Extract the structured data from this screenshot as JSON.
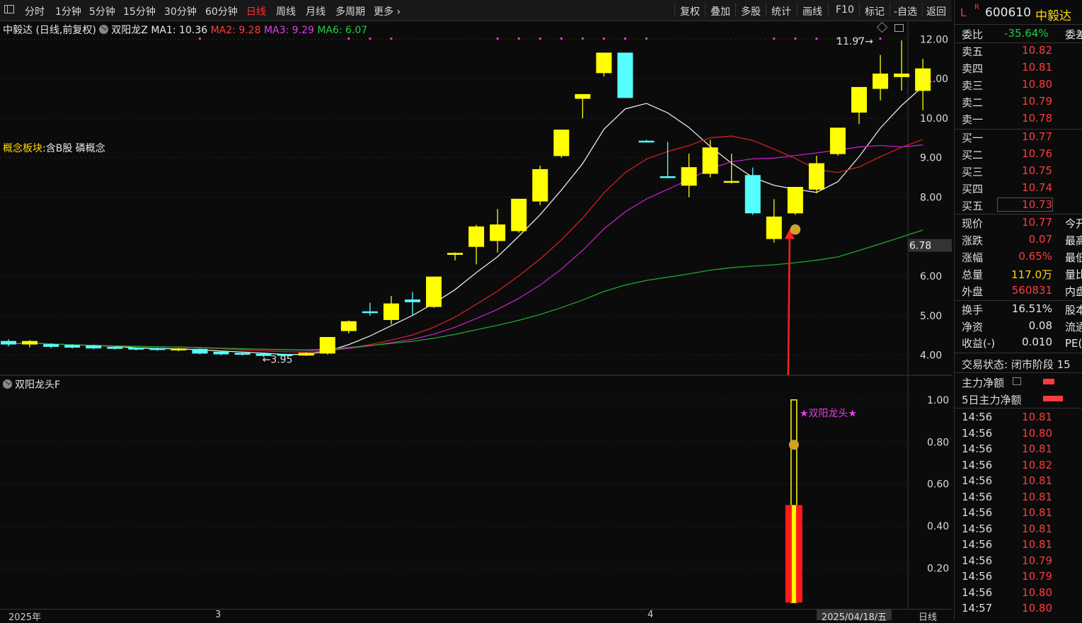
{
  "toolbar": {
    "tabs": [
      "分时",
      "1分钟",
      "5分钟",
      "15分钟",
      "30分钟",
      "60分钟",
      "日线",
      "周线",
      "月线",
      "多周期",
      "更多 ›"
    ],
    "active_tab": "日线",
    "right_buttons": [
      "复权",
      "叠加",
      "多股",
      "统计",
      "画线",
      "F10",
      "标记",
      "-自选",
      "返回"
    ]
  },
  "chart_header": {
    "title": "中毅达 (日线,前复权)",
    "formula": "双阳龙Z",
    "ma1": "MA1: 10.36",
    "ma2": "MA2: 9.28",
    "ma3": "MA3: 9.29",
    "ma6": "MA6: 6.07"
  },
  "concept": {
    "label": "概念板块",
    "value": ":含B股 磷概念"
  },
  "annotations": {
    "high": "11.97",
    "low": "3.95",
    "price_marker": "6.78"
  },
  "indicator": {
    "title": "双阳龙头F",
    "signal_text": "★双阳龙头★"
  },
  "y_axis_main": [
    "12.00",
    "11.00",
    "10.00",
    "9.00",
    "8.00",
    "6.00",
    "5.00",
    "4.00"
  ],
  "y_axis_ind": [
    "1.00",
    "0.80",
    "0.60",
    "0.40",
    "0.20"
  ],
  "date_axis": {
    "labels": [
      "2025年",
      "3",
      "4"
    ],
    "cursor": "2025/04/18/五",
    "period": "日线"
  },
  "colors": {
    "up": "#ffff00",
    "down": "#55ffff",
    "ma1": "#e8e8e8",
    "ma2": "#d02020",
    "ma3": "#c020c0",
    "ma6": "#1fa82a",
    "accent": "#ff3b3b"
  },
  "quote": {
    "code": "600610",
    "name": "中毅达",
    "badge_l": "L",
    "badge_r": "R",
    "weibi_label": "委比",
    "weibi": "-35.64%",
    "weicha_label": "委差",
    "sell": [
      {
        "l": "卖五",
        "p": "10.82"
      },
      {
        "l": "卖四",
        "p": "10.81"
      },
      {
        "l": "卖三",
        "p": "10.80"
      },
      {
        "l": "卖二",
        "p": "10.79"
      },
      {
        "l": "卖一",
        "p": "10.78"
      }
    ],
    "buy": [
      {
        "l": "买一",
        "p": "10.77"
      },
      {
        "l": "买二",
        "p": "10.76"
      },
      {
        "l": "买三",
        "p": "10.75"
      },
      {
        "l": "买四",
        "p": "10.74"
      },
      {
        "l": "买五",
        "p": "10.73"
      }
    ],
    "stats": [
      {
        "l": "现价",
        "v": "10.77",
        "r": "今开"
      },
      {
        "l": "涨跌",
        "v": "0.07",
        "r": "最高"
      },
      {
        "l": "涨幅",
        "v": "0.65%",
        "r": "最低"
      },
      {
        "l": "总量",
        "v": "117.0万",
        "r": "量比"
      },
      {
        "l": "外盘",
        "v": "560831",
        "r": "内盘"
      }
    ],
    "stats2": [
      {
        "l": "换手",
        "v": "16.51%",
        "r": "股本"
      },
      {
        "l": "净资",
        "v": "0.08",
        "r": "流通"
      },
      {
        "l": "收益(-)",
        "v": "0.010",
        "r": "PE(动)"
      }
    ],
    "trade_state": "交易状态: 闭市阶段 15",
    "main_net": "主力净额",
    "main_net5": "5日主力净额"
  },
  "ticks": [
    {
      "t": "14:56",
      "p": "10.81"
    },
    {
      "t": "14:56",
      "p": "10.80"
    },
    {
      "t": "14:56",
      "p": "10.81"
    },
    {
      "t": "14:56",
      "p": "10.82"
    },
    {
      "t": "14:56",
      "p": "10.81"
    },
    {
      "t": "14:56",
      "p": "10.81"
    },
    {
      "t": "14:56",
      "p": "10.81"
    },
    {
      "t": "14:56",
      "p": "10.81"
    },
    {
      "t": "14:56",
      "p": "10.81"
    },
    {
      "t": "14:56",
      "p": "10.79"
    },
    {
      "t": "14:56",
      "p": "10.79"
    },
    {
      "t": "14:56",
      "p": "10.80"
    },
    {
      "t": "14:57",
      "p": "10.80"
    }
  ],
  "candles": [
    {
      "o": 4.35,
      "c": 4.28,
      "h": 4.4,
      "l": 4.22
    },
    {
      "o": 4.28,
      "c": 4.35,
      "h": 4.38,
      "l": 4.2
    },
    {
      "o": 4.27,
      "c": 4.22,
      "h": 4.3,
      "l": 4.18
    },
    {
      "o": 4.25,
      "c": 4.2,
      "h": 4.27,
      "l": 4.17
    },
    {
      "o": 4.24,
      "c": 4.18,
      "h": 4.26,
      "l": 4.15
    },
    {
      "o": 4.2,
      "c": 4.17,
      "h": 4.22,
      "l": 4.14
    },
    {
      "o": 4.18,
      "c": 4.15,
      "h": 4.2,
      "l": 4.12
    },
    {
      "o": 4.17,
      "c": 4.14,
      "h": 4.19,
      "l": 4.11
    },
    {
      "o": 4.13,
      "c": 4.16,
      "h": 4.18,
      "l": 4.1
    },
    {
      "o": 4.15,
      "c": 4.05,
      "h": 4.17,
      "l": 4.02
    },
    {
      "o": 4.08,
      "c": 4.03,
      "h": 4.1,
      "l": 4.0
    },
    {
      "o": 4.05,
      "c": 4.02,
      "h": 4.08,
      "l": 3.99
    },
    {
      "o": 4.03,
      "c": 3.99,
      "h": 4.06,
      "l": 3.95
    },
    {
      "o": 4.02,
      "c": 4.0,
      "h": 4.04,
      "l": 3.97
    },
    {
      "o": 4.0,
      "c": 4.05,
      "h": 4.07,
      "l": 3.98
    },
    {
      "o": 4.05,
      "c": 4.45,
      "h": 4.45,
      "l": 4.02
    },
    {
      "o": 4.62,
      "c": 4.85,
      "h": 4.88,
      "l": 4.55
    },
    {
      "o": 5.1,
      "c": 5.08,
      "h": 5.33,
      "l": 5.0
    },
    {
      "o": 4.9,
      "c": 5.3,
      "h": 5.5,
      "l": 4.78
    },
    {
      "o": 5.4,
      "c": 5.35,
      "h": 5.6,
      "l": 5.0
    },
    {
      "o": 5.23,
      "c": 5.98,
      "h": 5.98,
      "l": 5.2
    },
    {
      "o": 6.55,
      "c": 6.58,
      "h": 6.6,
      "l": 6.4
    },
    {
      "o": 6.75,
      "c": 7.25,
      "h": 7.3,
      "l": 6.3
    },
    {
      "o": 6.9,
      "c": 7.3,
      "h": 7.7,
      "l": 6.6
    },
    {
      "o": 7.15,
      "c": 7.95,
      "h": 7.95,
      "l": 7.1
    },
    {
      "o": 7.9,
      "c": 8.7,
      "h": 8.8,
      "l": 7.8
    },
    {
      "o": 9.05,
      "c": 9.7,
      "h": 9.7,
      "l": 9.0
    },
    {
      "o": 10.5,
      "c": 10.6,
      "h": 10.6,
      "l": 10.0
    },
    {
      "o": 11.15,
      "c": 11.65,
      "h": 11.65,
      "l": 11.05
    },
    {
      "o": 11.65,
      "c": 10.52,
      "h": 11.65,
      "l": 10.52
    },
    {
      "o": 9.42,
      "c": 9.4,
      "h": 9.45,
      "l": 9.4
    },
    {
      "o": 8.52,
      "c": 8.5,
      "h": 9.4,
      "l": 8.5
    },
    {
      "o": 8.3,
      "c": 8.75,
      "h": 9.1,
      "l": 8.0
    },
    {
      "o": 8.6,
      "c": 9.25,
      "h": 9.45,
      "l": 8.5
    },
    {
      "o": 8.4,
      "c": 8.4,
      "h": 9.1,
      "l": 8.35
    },
    {
      "o": 8.55,
      "c": 7.6,
      "h": 8.75,
      "l": 7.55
    },
    {
      "o": 6.95,
      "c": 7.5,
      "h": 7.95,
      "l": 6.85
    },
    {
      "o": 7.6,
      "c": 8.25,
      "h": 8.25,
      "l": 7.55
    },
    {
      "o": 8.2,
      "c": 8.85,
      "h": 9.05,
      "l": 8.1
    },
    {
      "o": 9.1,
      "c": 9.75,
      "h": 9.75,
      "l": 9.05
    },
    {
      "o": 10.15,
      "c": 10.78,
      "h": 10.78,
      "l": 9.85
    },
    {
      "o": 10.75,
      "c": 11.12,
      "h": 11.6,
      "l": 10.45
    },
    {
      "o": 11.05,
      "c": 11.12,
      "h": 11.97,
      "l": 10.7
    },
    {
      "o": 10.7,
      "c": 11.25,
      "h": 11.5,
      "l": 10.2
    }
  ],
  "chart_data": {
    "type": "candlestick",
    "title": "中毅达 (日线,前复权)",
    "series": [
      {
        "name": "MA1",
        "last": 10.36
      },
      {
        "name": "MA2",
        "last": 9.28
      },
      {
        "name": "MA3",
        "last": 9.29
      },
      {
        "name": "MA6",
        "last": 6.07
      }
    ],
    "ylim": [
      3.6,
      12.4
    ],
    "indicator_ylim": [
      0,
      1.05
    ],
    "indicator_bar": {
      "value": 0.5,
      "signal": 1.0
    },
    "high_marker": 11.97,
    "low_marker": 3.95
  }
}
